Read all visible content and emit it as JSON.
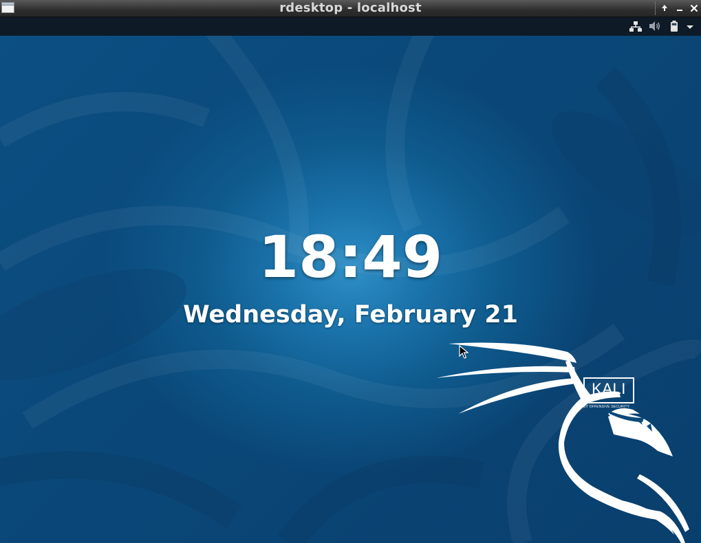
{
  "window": {
    "title": "rdesktop - localhost",
    "buttons": {
      "shade": "🠕",
      "minimize": "_",
      "close": "✕"
    }
  },
  "panel": {
    "icons": [
      "network-icon",
      "volume-icon",
      "battery-icon",
      "menu-dropdown-icon"
    ]
  },
  "lock_screen": {
    "time": "18:49",
    "date": "Wednesday, February 21"
  },
  "branding": {
    "logo_text": "KALI",
    "logo_subtext": "BY OFFENSIVE SECURITY"
  },
  "colors": {
    "background": "#0b4a7a",
    "glow": "#2f8fc6",
    "text": "#ffffff",
    "panel": "#101e2c"
  }
}
